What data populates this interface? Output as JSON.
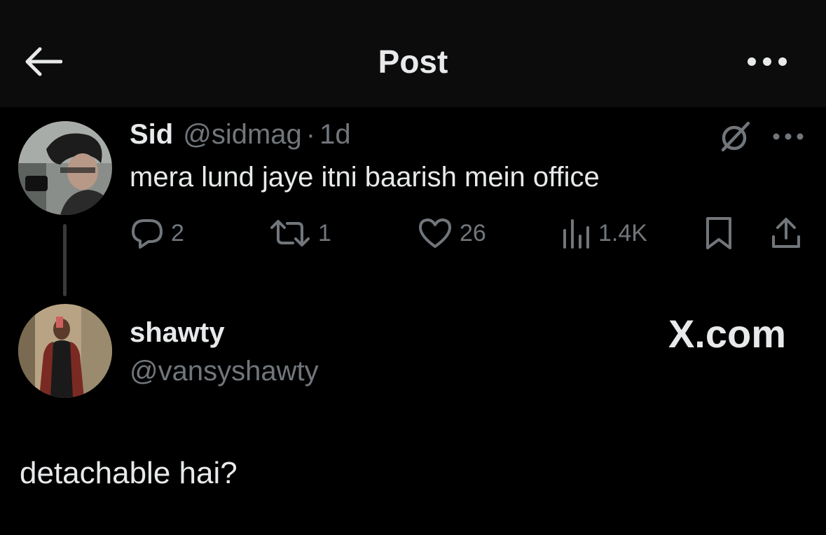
{
  "header": {
    "title": "Post",
    "back_icon": "arrow-left-icon",
    "more_icon": "more-horizontal-icon"
  },
  "original_tweet": {
    "name": "Sid",
    "handle": "@sidmag",
    "separator": "·",
    "time": "1d",
    "text": "mera lund jaye itni baarish mein office",
    "actions": {
      "replies": "2",
      "reposts": "1",
      "likes": "26",
      "views": "1.4K"
    }
  },
  "reply": {
    "name": "shawty",
    "handle": "@vansyshawty",
    "text": "detachable hai?"
  },
  "watermark": "X.com",
  "colors": {
    "background": "#000000",
    "header_background": "#0c0c0c",
    "primary_text": "#e7e9ea",
    "secondary_text": "#71767b"
  }
}
